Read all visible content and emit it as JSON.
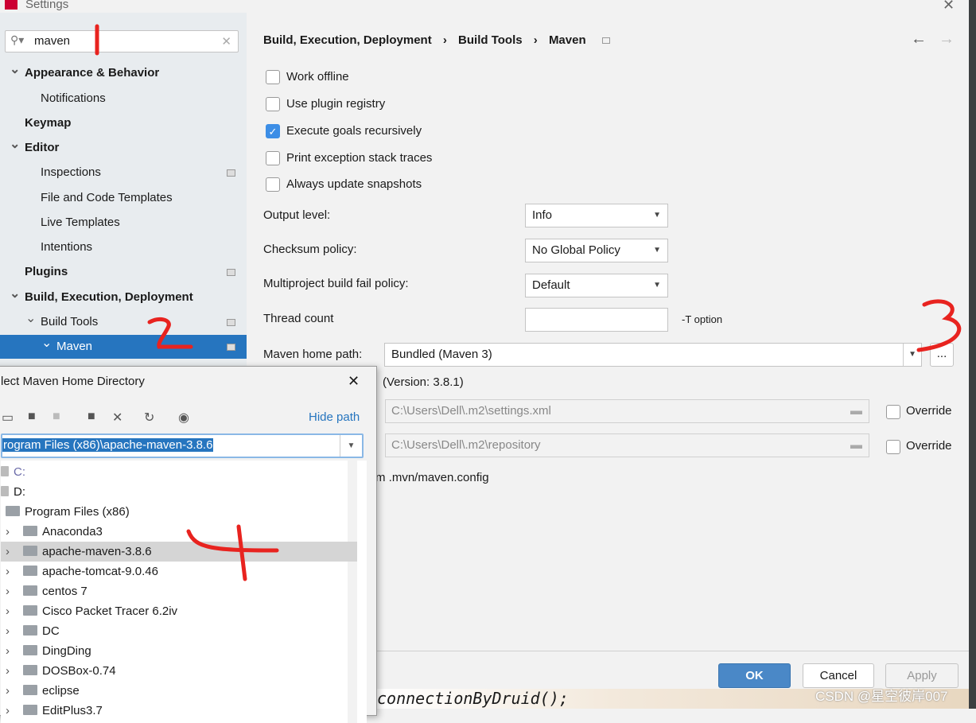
{
  "window": {
    "title": "Settings"
  },
  "search": {
    "value": "maven"
  },
  "sidebar": {
    "items": [
      {
        "label": "Appearance & Behavior",
        "bold": true,
        "expanded": true
      },
      {
        "label": "Notifications"
      },
      {
        "label": "Keymap",
        "bold": true
      },
      {
        "label": "Editor",
        "bold": true,
        "expanded": true
      },
      {
        "label": "Inspections"
      },
      {
        "label": "File and Code Templates"
      },
      {
        "label": "Live Templates"
      },
      {
        "label": "Intentions"
      },
      {
        "label": "Plugins",
        "bold": true
      },
      {
        "label": "Build, Execution, Deployment",
        "bold": true,
        "expanded": true
      },
      {
        "label": "Build Tools",
        "expanded": true
      },
      {
        "label": "Maven",
        "selected": true
      }
    ]
  },
  "breadcrumb": [
    "Build, Execution, Deployment",
    "Build Tools",
    "Maven"
  ],
  "options": [
    {
      "label": "Work offline",
      "checked": false
    },
    {
      "label": "Use plugin registry",
      "checked": false
    },
    {
      "label": "Execute goals recursively",
      "checked": true
    },
    {
      "label": "Print exception stack traces",
      "checked": false
    },
    {
      "label": "Always update snapshots",
      "checked": false
    }
  ],
  "output_level": {
    "label": "Output level:",
    "value": "Info"
  },
  "checksum_policy": {
    "label": "Checksum policy:",
    "value": "No Global Policy"
  },
  "fail_policy": {
    "label": "Multiproject build fail policy:",
    "value": "Default"
  },
  "thread_count": {
    "label": "Thread count",
    "value": "",
    "hint": "-T option"
  },
  "maven_home": {
    "label": "Maven home path:",
    "value": "Bundled (Maven 3)",
    "browse": "...",
    "version": "(Version: 3.8.1)"
  },
  "settings_file": {
    "value": "C:\\Users\\Dell\\.m2\\settings.xml",
    "override": "Override"
  },
  "repository": {
    "value": "C:\\Users\\Dell\\.m2\\repository",
    "override": "Override"
  },
  "config_text": "m .mvn/maven.config",
  "buttons": {
    "ok": "OK",
    "cancel": "Cancel",
    "apply": "Apply"
  },
  "background_code": "connectionByDruid();",
  "watermark": "CSDN @星空彼岸007",
  "dialog": {
    "title": "lect Maven Home Directory",
    "hide_path": "Hide path",
    "path": "rogram Files (x86)\\apache-maven-3.8.6",
    "tree": [
      {
        "label": "C:",
        "level": 0,
        "drive": true
      },
      {
        "label": "D:",
        "level": 0,
        "drive": true
      },
      {
        "label": "Program Files (x86)",
        "level": 1,
        "expanded": true
      },
      {
        "label": "Anaconda3",
        "level": 2
      },
      {
        "label": "apache-maven-3.8.6",
        "level": 2,
        "selected": true
      },
      {
        "label": "apache-tomcat-9.0.46",
        "level": 2
      },
      {
        "label": "centos 7",
        "level": 2
      },
      {
        "label": "Cisco Packet Tracer 6.2iv",
        "level": 2
      },
      {
        "label": "DC",
        "level": 2
      },
      {
        "label": "DingDing",
        "level": 2
      },
      {
        "label": "DOSBox-0.74",
        "level": 2
      },
      {
        "label": "eclipse",
        "level": 2
      },
      {
        "label": "EditPlus3.7",
        "level": 2
      }
    ]
  },
  "colors": {
    "accent": "#2675bf",
    "annotation": "#e8231f",
    "link": "#2675bf"
  }
}
